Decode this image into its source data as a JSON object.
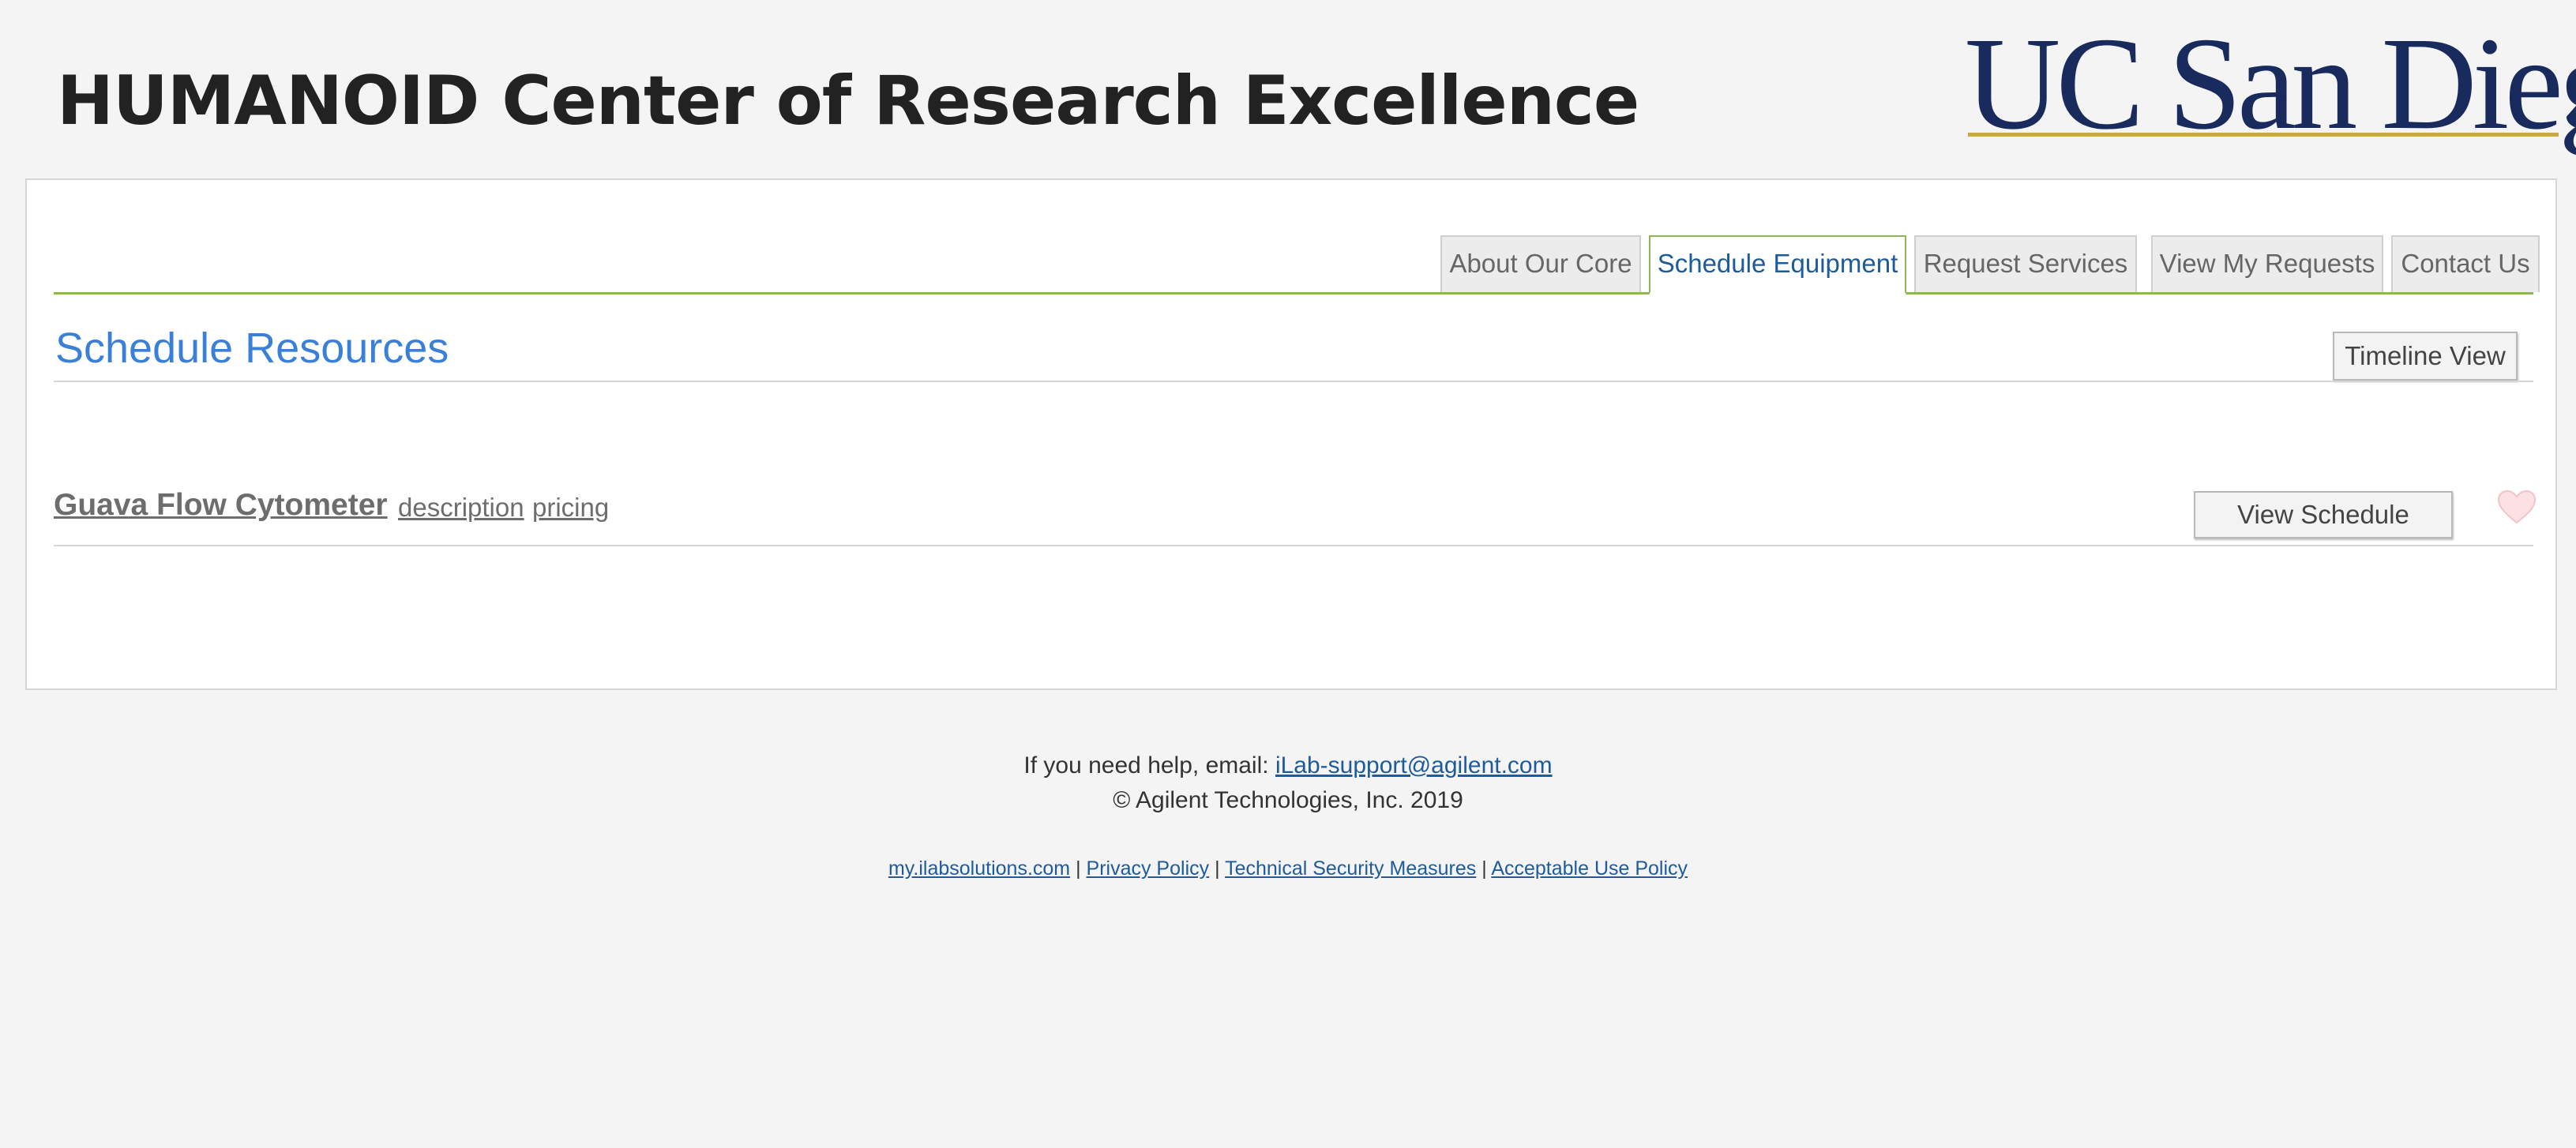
{
  "header": {
    "site_title": "HUMANOID Center of Research Excellence",
    "logo_text": "UC San Diego",
    "logo_colors": {
      "text": "#182b5c",
      "rule": "#c9a84d"
    }
  },
  "tabs": [
    {
      "label": "About Our Core",
      "active": false
    },
    {
      "label": "Schedule Equipment",
      "active": true
    },
    {
      "label": "Request Services",
      "active": false
    },
    {
      "label": "View My Requests",
      "active": false
    },
    {
      "label": "Contact Us",
      "active": false
    }
  ],
  "section": {
    "title": "Schedule Resources",
    "timeline_button": "Timeline View"
  },
  "resource": {
    "name": "Guava Flow Cytometer",
    "description_link": "description",
    "pricing_link": "pricing",
    "view_schedule_button": "View Schedule",
    "favorite_icon": "heart-icon"
  },
  "footer": {
    "help_prefix": "If you need help, email:",
    "help_email": "iLab-support@agilent.com",
    "copyright": "© Agilent Technologies, Inc. 2019",
    "links": [
      "my.ilabsolutions.com",
      "Privacy Policy",
      "Technical Security Measures",
      "Acceptable Use Policy"
    ],
    "separator": "|"
  },
  "colors": {
    "accent_blue": "#3a80d8",
    "link_blue": "#1e5b9a",
    "tab_border_green": "#8fb55a",
    "background": "#f4f4f4"
  }
}
